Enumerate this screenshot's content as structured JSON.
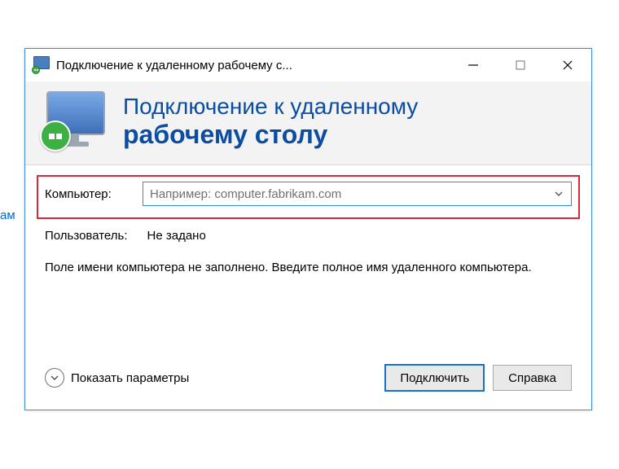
{
  "stray": "ам",
  "titlebar": {
    "title": "Подключение к удаленному рабочему с..."
  },
  "banner": {
    "line1": "Подключение к удаленному",
    "line2": "рабочему столу"
  },
  "form": {
    "computer_label": "Компьютер:",
    "computer_placeholder": "Например: computer.fabrikam.com",
    "user_label": "Пользователь:",
    "user_value": "Не задано",
    "info": "Поле имени компьютера не заполнено. Введите полное имя удаленного компьютера."
  },
  "footer": {
    "options_toggle": "Показать параметры",
    "connect": "Подключить",
    "help": "Справка"
  }
}
